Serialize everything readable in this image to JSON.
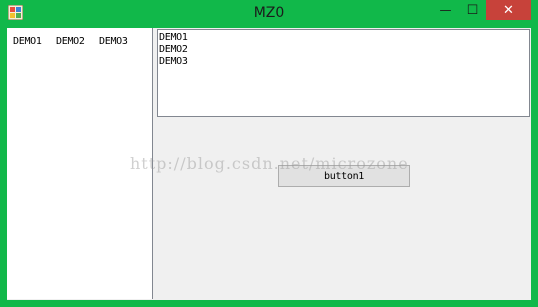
{
  "window": {
    "title": "MZ0",
    "accent_color": "#11b84a",
    "close_color": "#c7423a",
    "icon": "app-icon",
    "controls": {
      "minimize": "—",
      "maximize": "☐",
      "close": "✕"
    }
  },
  "listview": {
    "items": [
      "DEMO1",
      "DEMO2",
      "DEMO3"
    ]
  },
  "textbox": {
    "lines": [
      "DEMO1",
      "DEMO2",
      "DEMO3"
    ]
  },
  "button": {
    "label": "button1"
  },
  "watermark": "http://blog.csdn.net/microzone"
}
